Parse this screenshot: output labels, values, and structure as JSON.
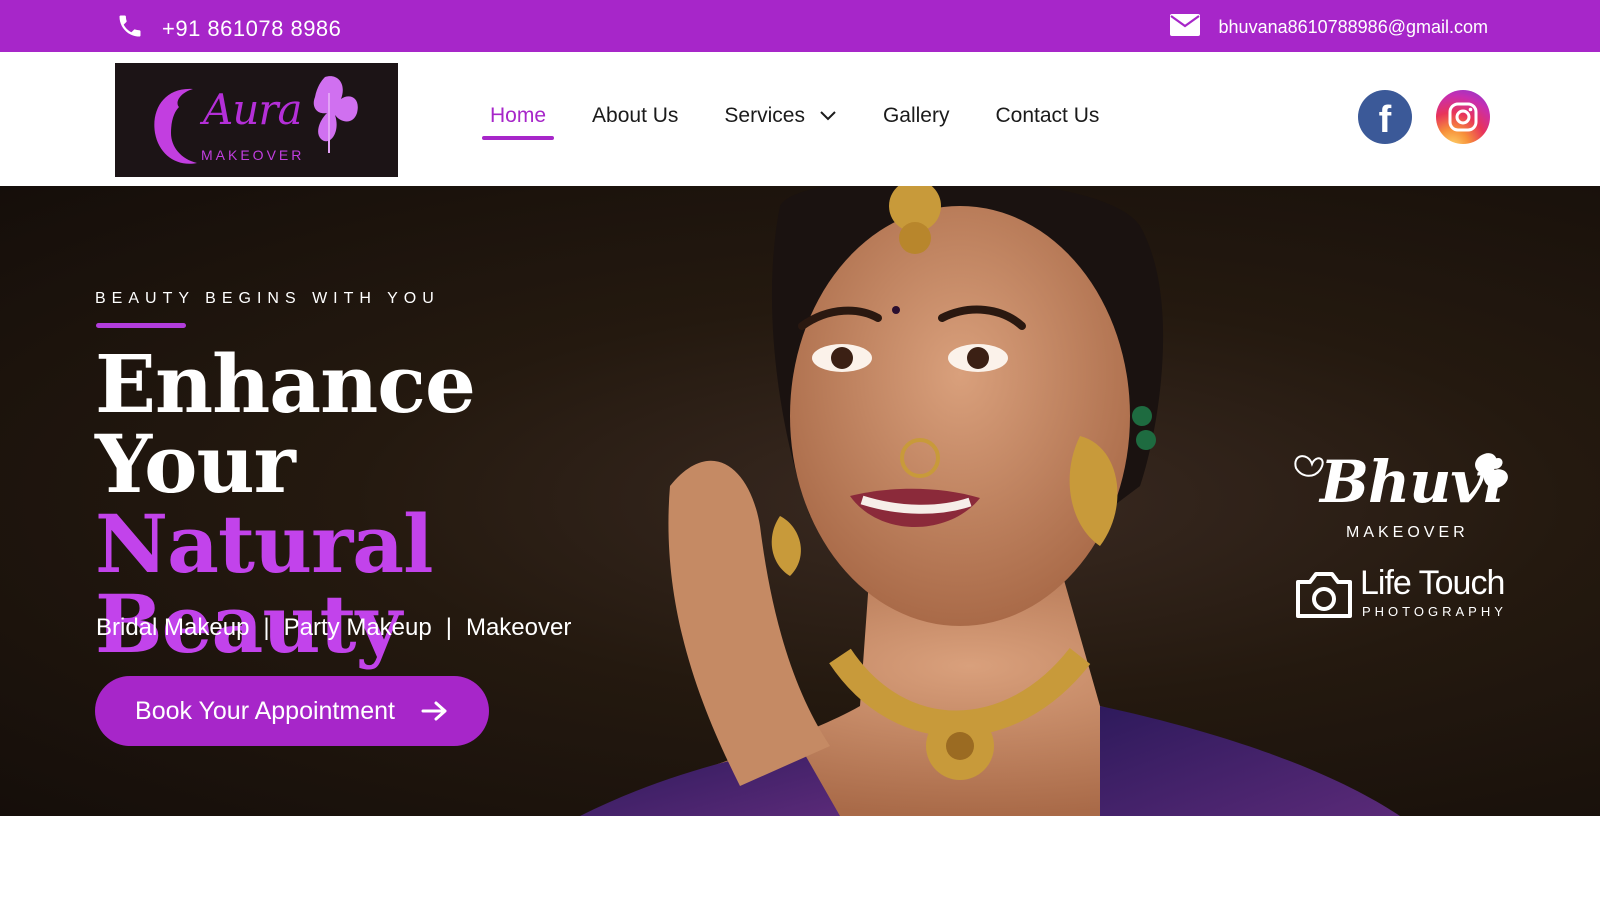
{
  "topbar": {
    "phone": "+91 861078 8986",
    "email": "bhuvana8610788986@gmail.com",
    "phone_icon": "phone-icon",
    "mail_icon": "envelope-icon"
  },
  "logo": {
    "word": "Aura",
    "sub": "MAKEOVER"
  },
  "nav": {
    "items": [
      {
        "label": "Home",
        "active": true
      },
      {
        "label": "About Us"
      },
      {
        "label": "Services",
        "has_dropdown": true
      },
      {
        "label": "Gallery"
      },
      {
        "label": "Contact Us"
      }
    ]
  },
  "social": {
    "facebook": "f",
    "instagram_icon": "instagram-icon"
  },
  "hero": {
    "tagline": "BEAUTY BEGINS WITH YOU",
    "headline_1": "Enhance",
    "headline_2a": "Your ",
    "headline_2b": "Natural",
    "headline_3": "Beauty",
    "service_1": "Bridal Makeup",
    "service_2": "Party Makeup",
    "service_3": "Makeover",
    "separator": "|",
    "cta_label": "Book Your Appointment"
  },
  "brands": {
    "brand1_name": "Bhuvi",
    "brand1_sub": "MAKEOVER",
    "brand2_name": "Life Touch",
    "brand2_sub": "PHOTOGRAPHY"
  },
  "colors": {
    "accent": "#a726c9",
    "headline_accent": "#c243eb",
    "hero_bg": "#24190f"
  }
}
